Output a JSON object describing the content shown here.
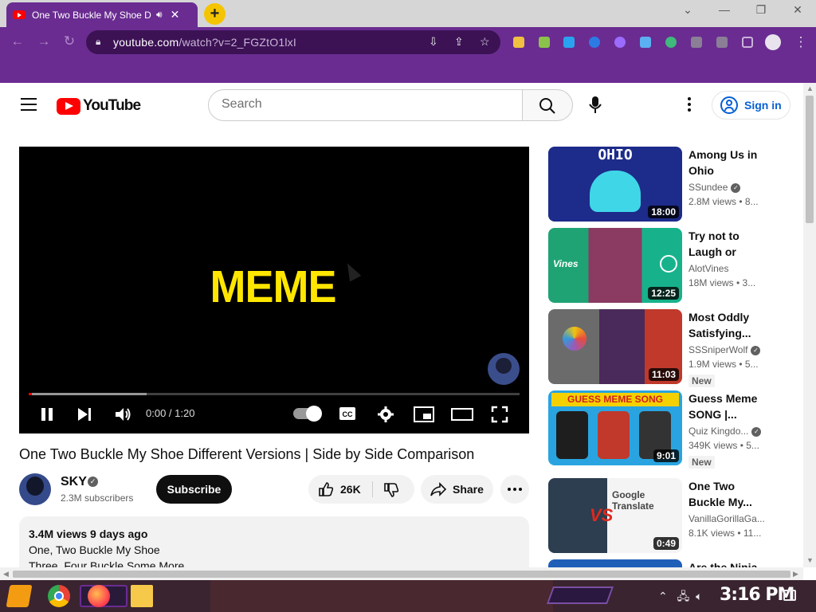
{
  "browser": {
    "tab_title": "One Two Buckle My Shoe D",
    "tab_audio_icon": "speaker-icon",
    "tab_close": "✕",
    "new_tab": "+",
    "url_host": "youtube.com",
    "url_path": "/watch?v=2_FGZtO1lxI",
    "window_controls": [
      "⌄",
      "—",
      "❐",
      "✕"
    ],
    "accent_color": "#6a2c91"
  },
  "header": {
    "logo_text": "YouTube",
    "search_placeholder": "Search",
    "signin_label": "Sign in"
  },
  "player": {
    "overlay_text": "MEME",
    "time_display": "0:00 / 1:20",
    "progress_played": 0.006,
    "progress_buffered": 0.24
  },
  "video": {
    "title": "One Two Buckle My Shoe Different Versions | Side by Side Comparison",
    "channel": "SKY",
    "subscribers": "2.3M subscribers",
    "subscribe_label": "Subscribe",
    "likes": "26K",
    "share_label": "Share",
    "description_meta": "3.4M views  9 days ago",
    "description_lines": [
      "One, Two Buckle My Shoe",
      "Three, Four Buckle Some More"
    ]
  },
  "related": [
    {
      "title_1": "Among Us in",
      "title_2": "Ohio",
      "channel": "SSundee",
      "views": "2.8M views  •  8...",
      "duration": "18:00",
      "thumb_text": "OHIO",
      "new": ""
    },
    {
      "title_1": "Try not to",
      "title_2": "Laugh or Grin...",
      "channel": "AlotVines",
      "views": "18M views  •  3...",
      "duration": "12:25",
      "thumb_text": "Vines",
      "new": ""
    },
    {
      "title_1": "Most Oddly",
      "title_2": "Satisfying...",
      "channel": "SSSniperWolf",
      "views": "1.9M views  •  5...",
      "duration": "11:03",
      "thumb_text": "",
      "new": "New"
    },
    {
      "title_1": "Guess Meme",
      "title_2": "SONG |...",
      "channel": "Quiz Kingdo...",
      "views": "349K views  •  5...",
      "duration": "9:01",
      "thumb_text": "GUESS MEME SONG",
      "new": "New"
    },
    {
      "title_1": "One Two",
      "title_2": "Buckle My...",
      "channel": "VanillaGorillaGa...",
      "views": "8.1K views  •  11...",
      "duration": "0:49",
      "thumb_text": "Google Translate",
      "new": ""
    },
    {
      "title_1": "Are the Ninja...",
      "title_2": "",
      "channel": "",
      "views": "",
      "duration": "",
      "thumb_text": "",
      "new": ""
    }
  ],
  "taskbar": {
    "clock": "3:16 PM"
  }
}
